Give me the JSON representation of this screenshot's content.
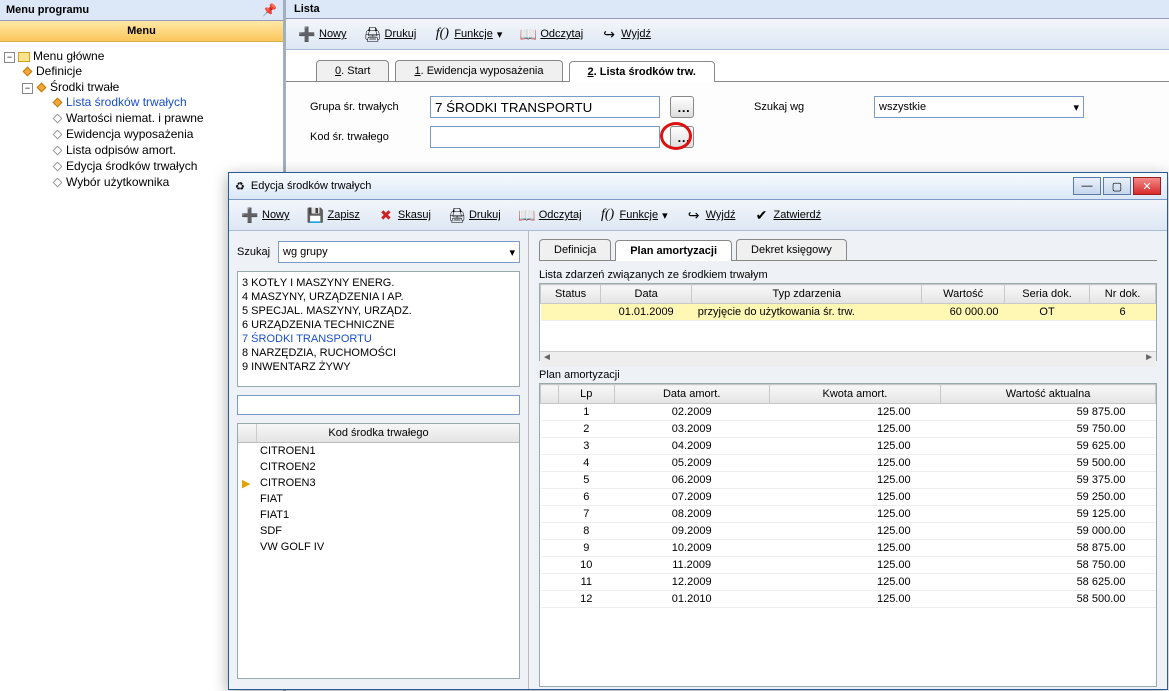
{
  "sidebar": {
    "title": "Menu programu",
    "menu_header": "Menu",
    "root": "Menu główne",
    "nodes": {
      "definicje": "Definicje",
      "srodki": "Środki trwałe"
    },
    "items": [
      "Lista środków trwałych",
      "Wartości niemat. i prawne",
      "Ewidencja wyposażenia",
      "Lista odpisów amort.",
      "Edycja środków trwałych",
      "Wybór użytkownika"
    ]
  },
  "main": {
    "title": "Lista",
    "toolbar": {
      "nowy": "Nowy",
      "drukuj": "Drukuj",
      "funkcje": "Funkcje",
      "odczytaj": "Odczytaj",
      "wyjdz": "Wyjdź"
    },
    "tabs": [
      "0. Start",
      "1. Ewidencja wyposażenia",
      "2. Lista środków trw."
    ],
    "active_tab": 2,
    "filter": {
      "grupa_label": "Grupa śr. trwałych",
      "grupa_value": "7 ŚRODKI TRANSPORTU",
      "kod_label": "Kod śr. trwałego",
      "kod_value": "",
      "szukaj_label": "Szukaj wg",
      "szukaj_value": "wszystkie"
    }
  },
  "dialog": {
    "title": "Edycja środków trwałych",
    "toolbar": {
      "nowy": "Nowy",
      "zapisz": "Zapisz",
      "skasuj": "Skasuj",
      "drukuj": "Drukuj",
      "odczytaj": "Odczytaj",
      "funkcje": "Funkcje",
      "wyjdz": "Wyjdź",
      "zatwierdz": "Zatwierdź"
    },
    "left": {
      "szukaj_label": "Szukaj",
      "szukaj_value": "wg grupy",
      "groups": [
        "3 KOTŁY I MASZYNY ENERG.",
        "4 MASZYNY, URZĄDZENIA I AP.",
        "5 SPECJAL. MASZYNY, URZĄDZ.",
        "6 URZĄDZENIA TECHNICZNE",
        "7 ŚRODKI TRANSPORTU",
        "8 NARZĘDZIA, RUCHOMOŚCI",
        "9 INWENTARZ ŻYWY"
      ],
      "groups_selected": 4,
      "code_header": "Kod środka trwałego",
      "codes": [
        "CITROEN1",
        "CITROEN2",
        "CITROEN3",
        "FIAT",
        "FIAT1",
        "SDF",
        "VW GOLF IV"
      ],
      "codes_current": 2
    },
    "right": {
      "tabs": [
        "Definicja",
        "Plan amortyzacji",
        "Dekret księgowy"
      ],
      "active_tab": 1,
      "events": {
        "label": "Lista zdarzeń związanych ze środkiem trwałym",
        "cols": [
          "Status",
          "Data",
          "Typ zdarzenia",
          "Wartość",
          "Seria dok.",
          "Nr dok."
        ],
        "rows": [
          {
            "status": "",
            "data": "01.01.2009",
            "typ": "przyjęcie do użytkowania śr. trw.",
            "wartosc": "60 000.00",
            "seria": "OT",
            "nr": "6"
          }
        ]
      },
      "plan": {
        "label": "Plan amortyzacji",
        "cols": [
          "Lp",
          "Data amort.",
          "Kwota amort.",
          "Wartość aktualna"
        ],
        "rows": [
          {
            "lp": "1",
            "data": "02.2009",
            "kwota": "125.00",
            "wart": "59 875.00"
          },
          {
            "lp": "2",
            "data": "03.2009",
            "kwota": "125.00",
            "wart": "59 750.00"
          },
          {
            "lp": "3",
            "data": "04.2009",
            "kwota": "125.00",
            "wart": "59 625.00"
          },
          {
            "lp": "4",
            "data": "05.2009",
            "kwota": "125.00",
            "wart": "59 500.00"
          },
          {
            "lp": "5",
            "data": "06.2009",
            "kwota": "125.00",
            "wart": "59 375.00"
          },
          {
            "lp": "6",
            "data": "07.2009",
            "kwota": "125.00",
            "wart": "59 250.00"
          },
          {
            "lp": "7",
            "data": "08.2009",
            "kwota": "125.00",
            "wart": "59 125.00"
          },
          {
            "lp": "8",
            "data": "09.2009",
            "kwota": "125.00",
            "wart": "59 000.00"
          },
          {
            "lp": "9",
            "data": "10.2009",
            "kwota": "125.00",
            "wart": "58 875.00"
          },
          {
            "lp": "10",
            "data": "11.2009",
            "kwota": "125.00",
            "wart": "58 750.00"
          },
          {
            "lp": "11",
            "data": "12.2009",
            "kwota": "125.00",
            "wart": "58 625.00"
          },
          {
            "lp": "12",
            "data": "01.2010",
            "kwota": "125.00",
            "wart": "58 500.00"
          }
        ]
      }
    }
  }
}
